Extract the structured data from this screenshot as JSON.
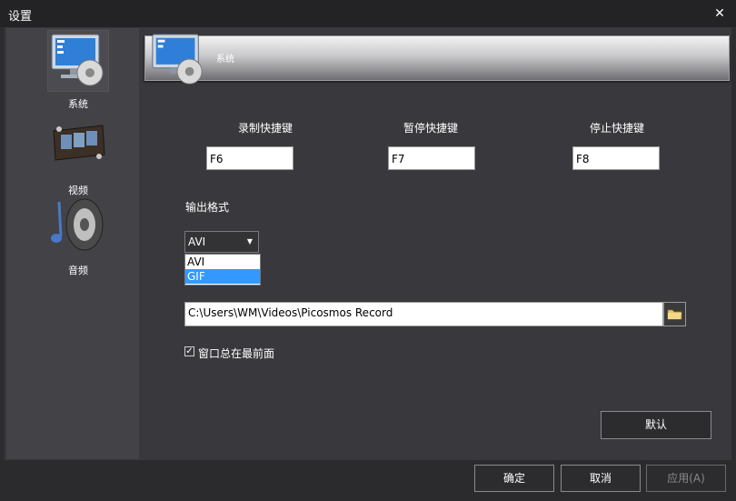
{
  "window": {
    "title": "设置",
    "close_glyph": "✕"
  },
  "sidebar": {
    "items": [
      {
        "label": "系统",
        "icon": "monitor-gear-icon",
        "active": true
      },
      {
        "label": "视频",
        "icon": "film-strip-icon",
        "active": false
      },
      {
        "label": "音频",
        "icon": "speaker-icon",
        "active": false
      }
    ]
  },
  "header": {
    "title": "系统",
    "icon": "monitor-gear-icon"
  },
  "hotkeys": {
    "record": {
      "label": "录制快捷键",
      "value": "F6"
    },
    "pause": {
      "label": "暂停快捷键",
      "value": "F7"
    },
    "stop": {
      "label": "停止快捷键",
      "value": "F8"
    }
  },
  "output_format": {
    "label": "输出格式",
    "selected": "AVI",
    "options": [
      "AVI",
      "GIF"
    ],
    "highlighted_option": "GIF"
  },
  "output_path": {
    "value": "C:\\Users\\WM\\Videos\\Picosmos Record",
    "browse_icon": "folder-icon"
  },
  "always_on_top": {
    "label": "窗口总在最前面",
    "checked": true
  },
  "buttons": {
    "default": "默认",
    "ok": "确定",
    "cancel": "取消",
    "apply": "应用(A)"
  },
  "colors": {
    "background": "#2d2d30",
    "panel": "#39393d",
    "sidebar": "#424247",
    "highlight": "#3399ff"
  }
}
